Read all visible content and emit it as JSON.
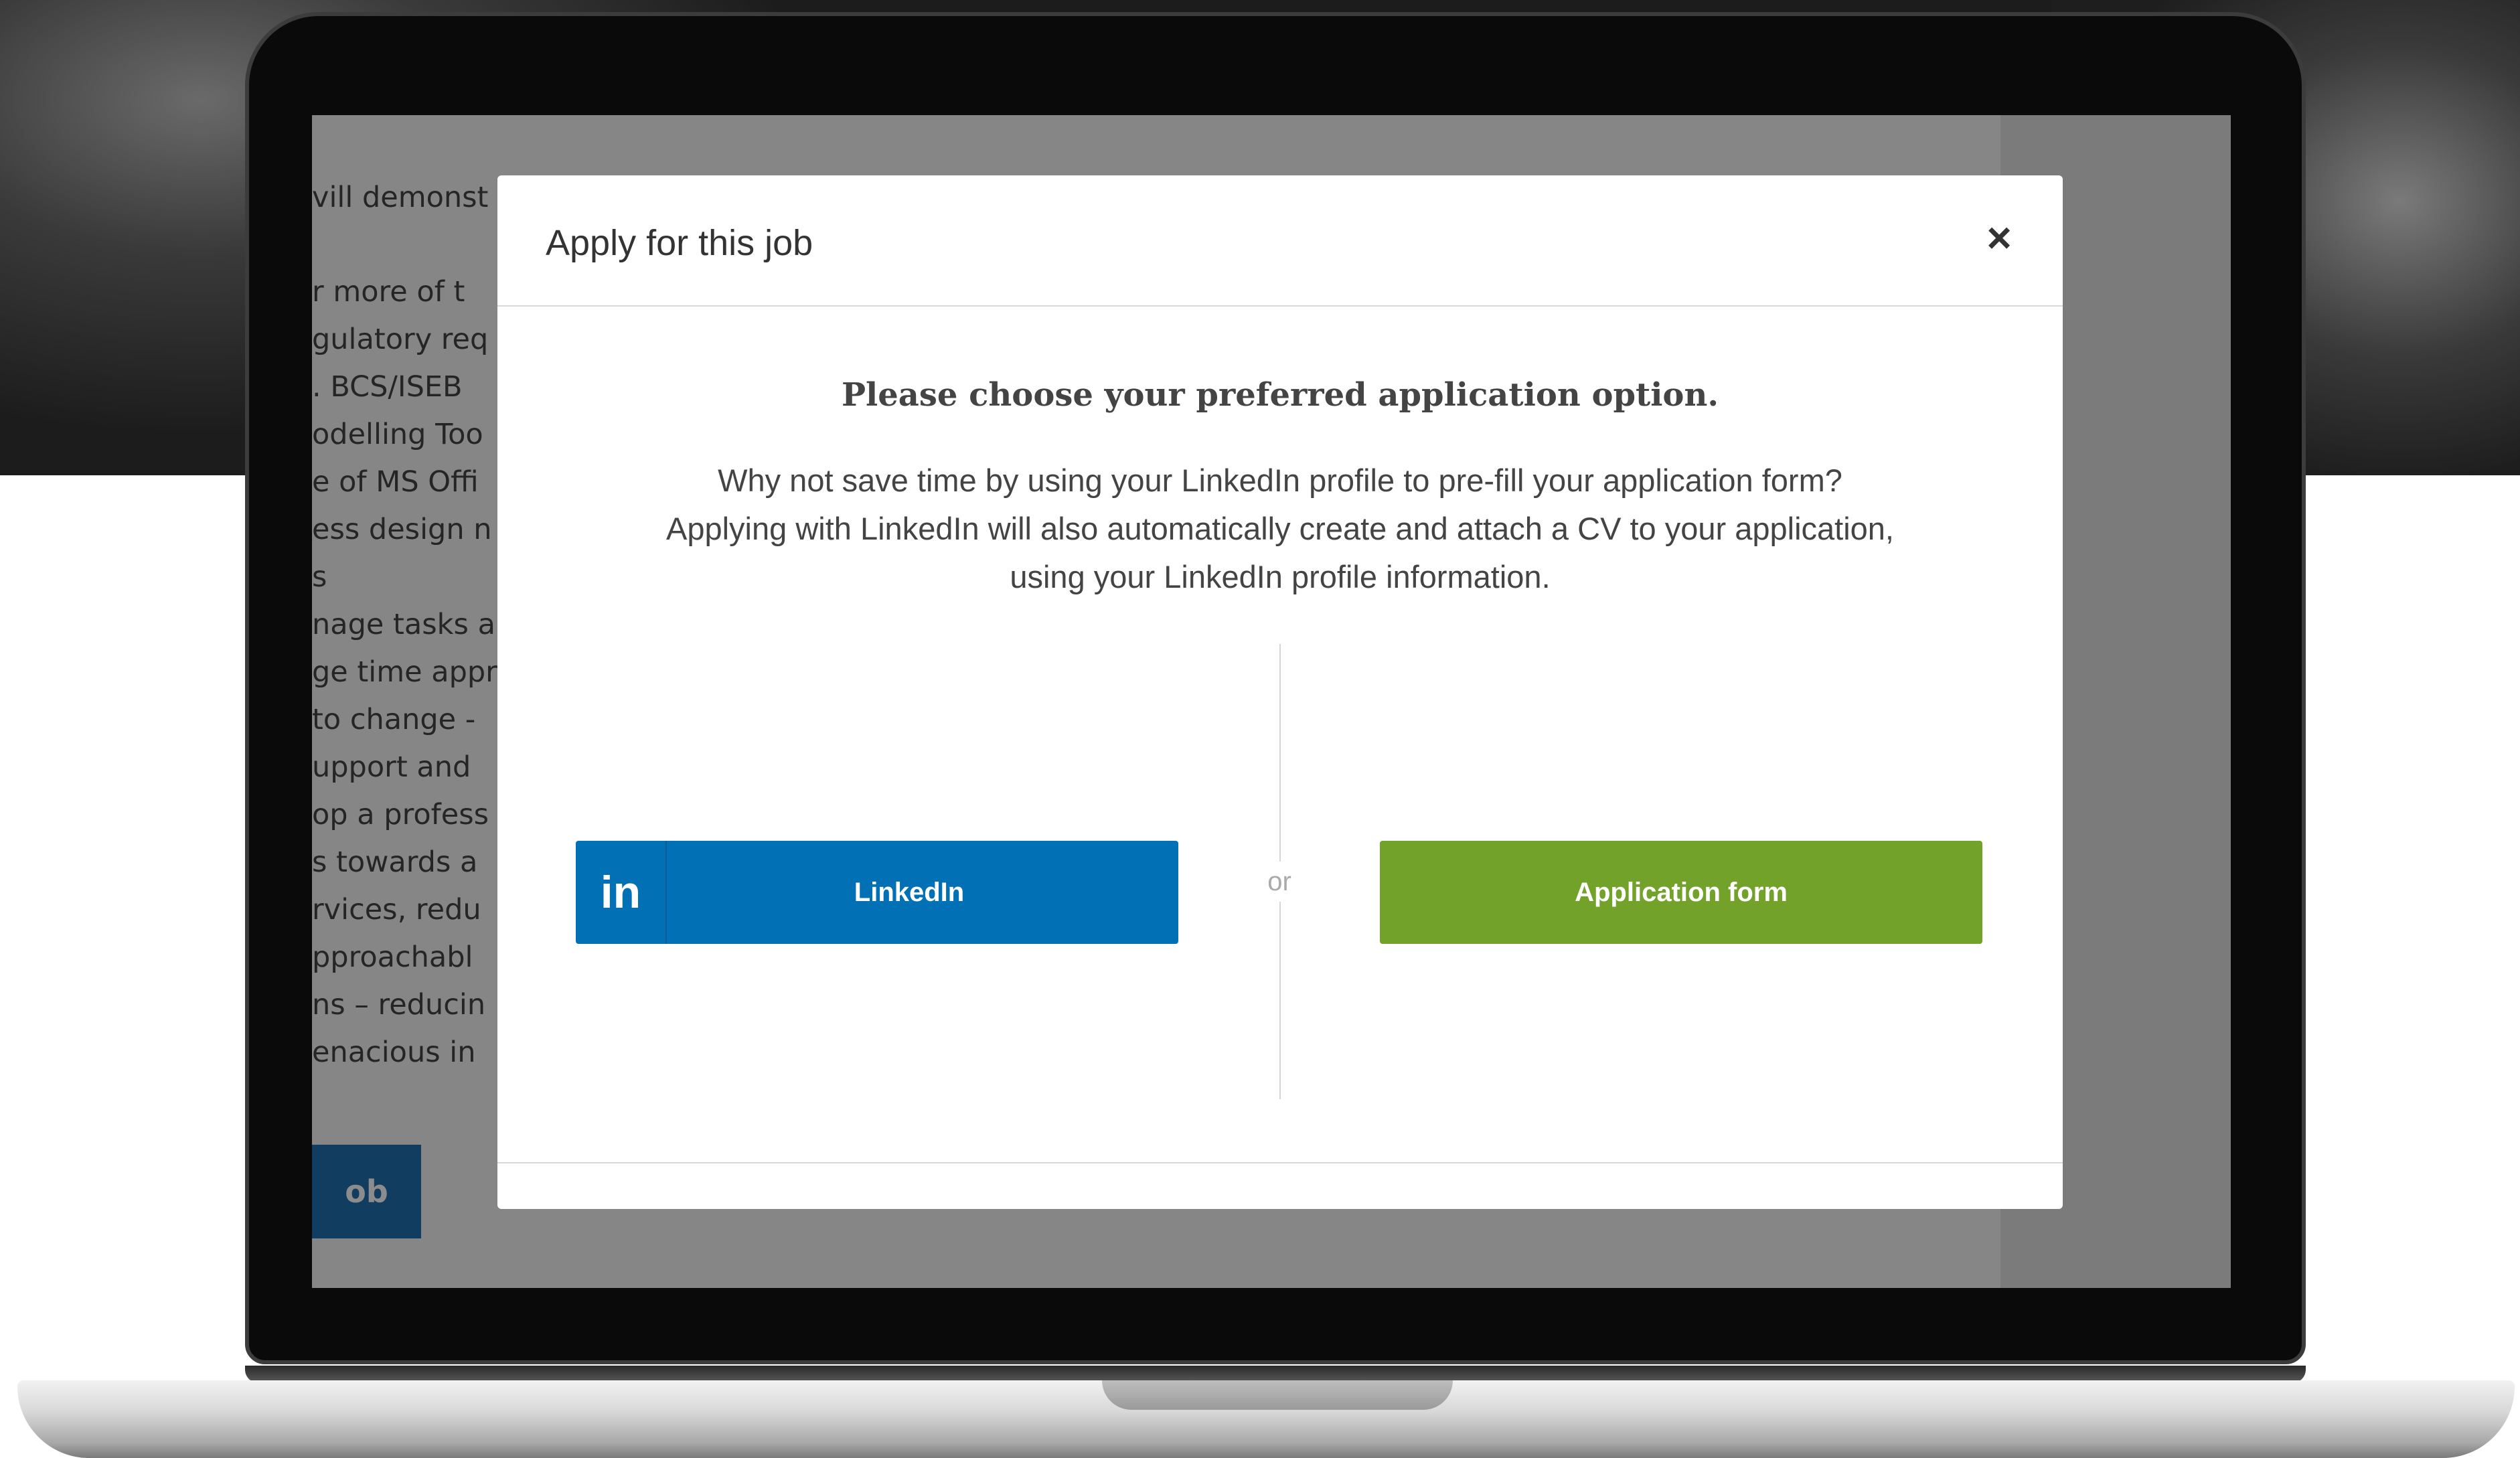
{
  "background_page": {
    "lines": [
      "vill demonst",
      "",
      "r more of t",
      "gulatory req",
      ". BCS/ISEB",
      "odelling Too",
      "e of MS Offi",
      "ess design n",
      "s",
      "nage tasks a",
      "ge time appr",
      "to change -",
      "upport and",
      "op a profess",
      "s towards a",
      "rvices, redu",
      "pproachabl",
      "ns – reducin",
      "enacious in"
    ],
    "apply_button_label": "ob"
  },
  "modal": {
    "title": "Apply for this job",
    "close_label": "×",
    "heading": "Please choose your preferred application option.",
    "description_lines": [
      "Why not save time by using your LinkedIn profile to pre-fill your application form?",
      "Applying with LinkedIn will also automatically create and attach a CV to your application,",
      "using your LinkedIn profile information."
    ],
    "linkedin_icon_text": "in",
    "linkedin_button_label": "LinkedIn",
    "or_label": "or",
    "application_form_button_label": "Application form"
  },
  "colors": {
    "linkedin_blue": "#0270b5",
    "application_green": "#73a22b",
    "page_button_blue": "#1f6fb0"
  }
}
